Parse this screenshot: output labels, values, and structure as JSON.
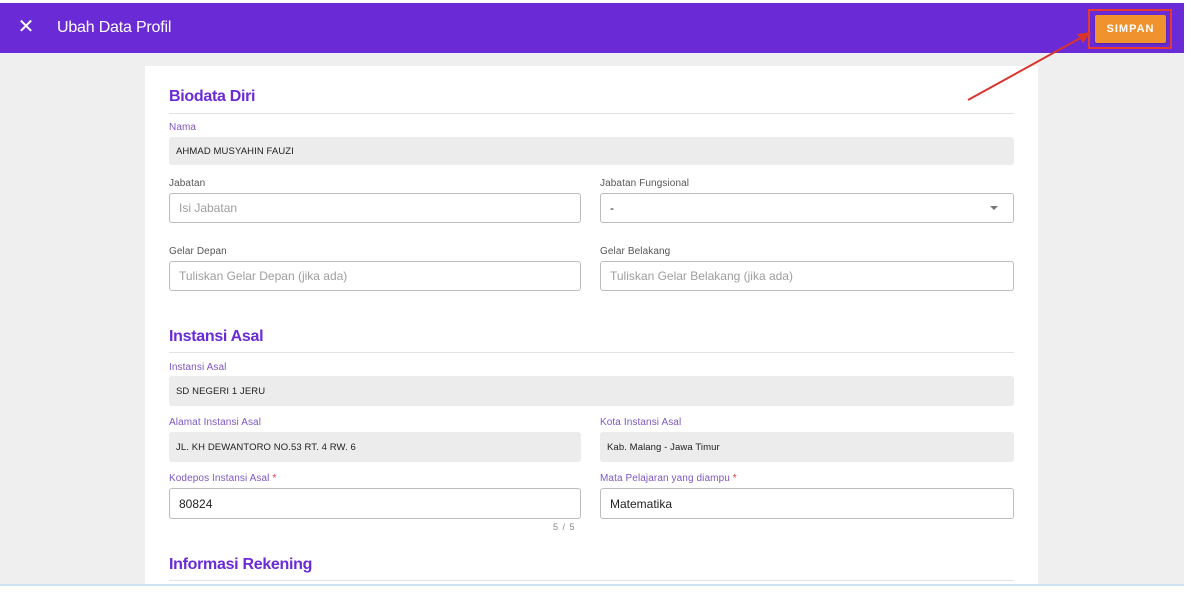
{
  "header": {
    "title": "Ubah Data Profil",
    "close_icon": "close-icon",
    "save_label": "SIMPAN",
    "accent_color": "#6a2bd6",
    "save_color": "#f0922e",
    "highlight_color": "#e53935"
  },
  "biodata": {
    "section_title": "Biodata Diri",
    "nama": {
      "label": "Nama",
      "value": "AHMAD MUSYAHIN FAUZI"
    },
    "jabatan": {
      "label": "Jabatan",
      "placeholder": "Isi Jabatan"
    },
    "jabatan_fungsional": {
      "label": "Jabatan Fungsional",
      "value": "-"
    },
    "gelar_depan": {
      "label": "Gelar Depan",
      "placeholder": "Tuliskan Gelar Depan (jika ada)"
    },
    "gelar_belakang": {
      "label": "Gelar Belakang",
      "placeholder": "Tuliskan Gelar Belakang (jika ada)"
    }
  },
  "instansi": {
    "section_title": "Instansi Asal",
    "instansi_asal": {
      "label": "Instansi Asal",
      "value": "SD NEGERI 1 JERU"
    },
    "alamat": {
      "label": "Alamat Instansi Asal",
      "value": "JL. KH DEWANTORO NO.53 RT. 4 RW. 6"
    },
    "kota": {
      "label": "Kota Instansi Asal",
      "value": "Kab. Malang - Jawa Timur"
    },
    "kodepos": {
      "label": "Kodepos Instansi Asal",
      "required_mark": "*",
      "value": "80824",
      "counter": "5 / 5"
    },
    "mapel": {
      "label": "Mata Pelajaran yang diampu",
      "required_mark": "*",
      "value": "Matematika"
    }
  },
  "rekening": {
    "section_title": "Informasi Rekening"
  }
}
